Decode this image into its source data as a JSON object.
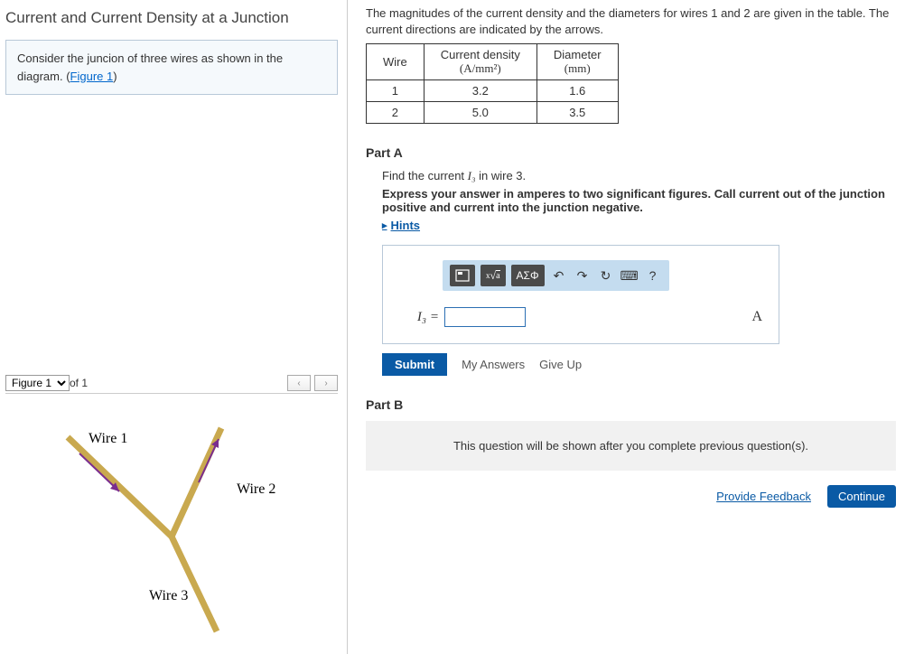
{
  "title": "Current and Current Density at a Junction",
  "problem": {
    "text_prefix": "Consider the juncion of three wires as shown in the diagram. (",
    "figure_link": "Figure 1",
    "text_suffix": ")"
  },
  "figure": {
    "selector_label": "Figure 1",
    "of_label": " of 1",
    "wire1_label": "Wire 1",
    "wire2_label": "Wire 2",
    "wire3_label": "Wire 3"
  },
  "intro": "The magnitudes of the current density and the diameters for wires 1 and 2 are given in the table. The current directions are indicated by the arrows.",
  "table": {
    "h_wire": "Wire",
    "h_density_line1": "Current density",
    "h_density_line2": "(A/mm²)",
    "h_diam_line1": "Diameter",
    "h_diam_line2": "(mm)",
    "rows": [
      {
        "wire": "1",
        "density": "3.2",
        "diameter": "1.6"
      },
      {
        "wire": "2",
        "density": "5.0",
        "diameter": "3.5"
      }
    ]
  },
  "chart_data": {
    "type": "table",
    "columns": [
      "Wire",
      "Current density (A/mm²)",
      "Diameter (mm)"
    ],
    "rows": [
      [
        "1",
        3.2,
        1.6
      ],
      [
        "2",
        5.0,
        3.5
      ]
    ]
  },
  "partA": {
    "header": "Part A",
    "prompt_prefix": "Find the current ",
    "prompt_var": "I₃",
    "prompt_suffix": " in wire 3.",
    "instruction": "Express your answer in amperes to two significant figures. Call current out of the junction positive and current into the junction negative.",
    "hints_label": "Hints",
    "greek_label": "ΑΣΦ",
    "var_label": "I₃ =",
    "unit": "A",
    "submit": "Submit",
    "my_answers": "My Answers",
    "give_up": "Give Up",
    "answer_value": ""
  },
  "partB": {
    "header": "Part B",
    "locked_msg": "This question will be shown after you complete previous question(s)."
  },
  "footer": {
    "feedback": "Provide Feedback",
    "continue": "Continue"
  }
}
